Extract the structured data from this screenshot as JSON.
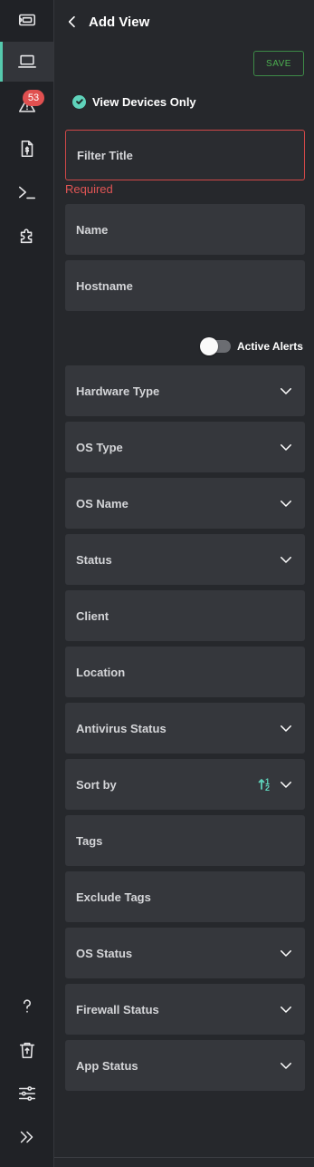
{
  "sidebar": {
    "items": [
      {
        "name": "ticket-icon"
      },
      {
        "name": "laptop-icon",
        "active": true
      },
      {
        "name": "alert-triangle-icon",
        "badge": "53"
      },
      {
        "name": "invoice-icon"
      },
      {
        "name": "terminal-icon"
      },
      {
        "name": "puzzle-icon"
      }
    ],
    "bottom_items": [
      {
        "name": "help-icon"
      },
      {
        "name": "recycle-bin-icon"
      },
      {
        "name": "sliders-icon"
      },
      {
        "name": "expand-icon"
      }
    ]
  },
  "header": {
    "title": "Add View"
  },
  "save_label": "SAVE",
  "view_devices_only": {
    "label": "View Devices Only",
    "checked": true
  },
  "filter_title": {
    "placeholder": "Filter Title",
    "error": "Required"
  },
  "fields_top": [
    {
      "label": "Name",
      "type": "input"
    },
    {
      "label": "Hostname",
      "type": "input"
    }
  ],
  "active_alerts": {
    "label": "Active Alerts",
    "on": false
  },
  "fields": [
    {
      "label": "Hardware Type",
      "type": "select"
    },
    {
      "label": "OS Type",
      "type": "select"
    },
    {
      "label": "OS Name",
      "type": "select"
    },
    {
      "label": "Status",
      "type": "select"
    },
    {
      "label": "Client",
      "type": "input"
    },
    {
      "label": "Location",
      "type": "input"
    },
    {
      "label": "Antivirus Status",
      "type": "select"
    },
    {
      "label": "Sort by",
      "type": "select",
      "sort_icon": "sort-ascending-icon"
    },
    {
      "label": "Tags",
      "type": "input"
    },
    {
      "label": "Exclude Tags",
      "type": "input"
    },
    {
      "label": "OS Status",
      "type": "select"
    },
    {
      "label": "Firewall Status",
      "type": "select"
    },
    {
      "label": "App Status",
      "type": "select"
    }
  ],
  "colors": {
    "accent": "#5fd3bb",
    "error": "#e05555",
    "save": "#4caf50",
    "badge": "#e05050"
  }
}
